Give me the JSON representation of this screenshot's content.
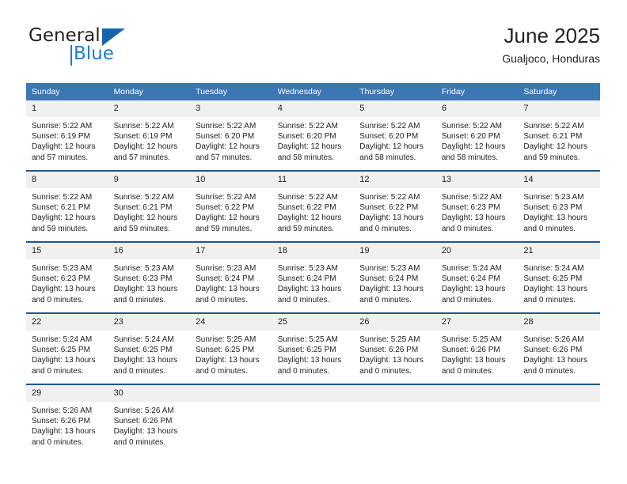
{
  "brand": {
    "name_top": "General",
    "name_bottom": "Blue",
    "accent_color": "#1a7fd4",
    "triangle_color": "#1565ad"
  },
  "header": {
    "title": "June 2025",
    "subtitle": "Gualjoco, Honduras"
  },
  "theme": {
    "header_row_bg": "#3b76b5",
    "week_separator": "#21578f",
    "daynum_bg": "#f0f0f0",
    "text": "#222222"
  },
  "weekday_headers": [
    "Sunday",
    "Monday",
    "Tuesday",
    "Wednesday",
    "Thursday",
    "Friday",
    "Saturday"
  ],
  "labels": {
    "sunrise_prefix": "Sunrise: ",
    "sunset_prefix": "Sunset: ",
    "daylight_prefix": "Daylight: "
  },
  "weeks": [
    [
      {
        "day": "1",
        "sunrise": "Sunrise: 5:22 AM",
        "sunset": "Sunset: 6:19 PM",
        "daylight": "Daylight: 12 hours and 57 minutes."
      },
      {
        "day": "2",
        "sunrise": "Sunrise: 5:22 AM",
        "sunset": "Sunset: 6:19 PM",
        "daylight": "Daylight: 12 hours and 57 minutes."
      },
      {
        "day": "3",
        "sunrise": "Sunrise: 5:22 AM",
        "sunset": "Sunset: 6:20 PM",
        "daylight": "Daylight: 12 hours and 57 minutes."
      },
      {
        "day": "4",
        "sunrise": "Sunrise: 5:22 AM",
        "sunset": "Sunset: 6:20 PM",
        "daylight": "Daylight: 12 hours and 58 minutes."
      },
      {
        "day": "5",
        "sunrise": "Sunrise: 5:22 AM",
        "sunset": "Sunset: 6:20 PM",
        "daylight": "Daylight: 12 hours and 58 minutes."
      },
      {
        "day": "6",
        "sunrise": "Sunrise: 5:22 AM",
        "sunset": "Sunset: 6:20 PM",
        "daylight": "Daylight: 12 hours and 58 minutes."
      },
      {
        "day": "7",
        "sunrise": "Sunrise: 5:22 AM",
        "sunset": "Sunset: 6:21 PM",
        "daylight": "Daylight: 12 hours and 59 minutes."
      }
    ],
    [
      {
        "day": "8",
        "sunrise": "Sunrise: 5:22 AM",
        "sunset": "Sunset: 6:21 PM",
        "daylight": "Daylight: 12 hours and 59 minutes."
      },
      {
        "day": "9",
        "sunrise": "Sunrise: 5:22 AM",
        "sunset": "Sunset: 6:21 PM",
        "daylight": "Daylight: 12 hours and 59 minutes."
      },
      {
        "day": "10",
        "sunrise": "Sunrise: 5:22 AM",
        "sunset": "Sunset: 6:22 PM",
        "daylight": "Daylight: 12 hours and 59 minutes."
      },
      {
        "day": "11",
        "sunrise": "Sunrise: 5:22 AM",
        "sunset": "Sunset: 6:22 PM",
        "daylight": "Daylight: 12 hours and 59 minutes."
      },
      {
        "day": "12",
        "sunrise": "Sunrise: 5:22 AM",
        "sunset": "Sunset: 6:22 PM",
        "daylight": "Daylight: 13 hours and 0 minutes."
      },
      {
        "day": "13",
        "sunrise": "Sunrise: 5:22 AM",
        "sunset": "Sunset: 6:23 PM",
        "daylight": "Daylight: 13 hours and 0 minutes."
      },
      {
        "day": "14",
        "sunrise": "Sunrise: 5:23 AM",
        "sunset": "Sunset: 6:23 PM",
        "daylight": "Daylight: 13 hours and 0 minutes."
      }
    ],
    [
      {
        "day": "15",
        "sunrise": "Sunrise: 5:23 AM",
        "sunset": "Sunset: 6:23 PM",
        "daylight": "Daylight: 13 hours and 0 minutes."
      },
      {
        "day": "16",
        "sunrise": "Sunrise: 5:23 AM",
        "sunset": "Sunset: 6:23 PM",
        "daylight": "Daylight: 13 hours and 0 minutes."
      },
      {
        "day": "17",
        "sunrise": "Sunrise: 5:23 AM",
        "sunset": "Sunset: 6:24 PM",
        "daylight": "Daylight: 13 hours and 0 minutes."
      },
      {
        "day": "18",
        "sunrise": "Sunrise: 5:23 AM",
        "sunset": "Sunset: 6:24 PM",
        "daylight": "Daylight: 13 hours and 0 minutes."
      },
      {
        "day": "19",
        "sunrise": "Sunrise: 5:23 AM",
        "sunset": "Sunset: 6:24 PM",
        "daylight": "Daylight: 13 hours and 0 minutes."
      },
      {
        "day": "20",
        "sunrise": "Sunrise: 5:24 AM",
        "sunset": "Sunset: 6:24 PM",
        "daylight": "Daylight: 13 hours and 0 minutes."
      },
      {
        "day": "21",
        "sunrise": "Sunrise: 5:24 AM",
        "sunset": "Sunset: 6:25 PM",
        "daylight": "Daylight: 13 hours and 0 minutes."
      }
    ],
    [
      {
        "day": "22",
        "sunrise": "Sunrise: 5:24 AM",
        "sunset": "Sunset: 6:25 PM",
        "daylight": "Daylight: 13 hours and 0 minutes."
      },
      {
        "day": "23",
        "sunrise": "Sunrise: 5:24 AM",
        "sunset": "Sunset: 6:25 PM",
        "daylight": "Daylight: 13 hours and 0 minutes."
      },
      {
        "day": "24",
        "sunrise": "Sunrise: 5:25 AM",
        "sunset": "Sunset: 6:25 PM",
        "daylight": "Daylight: 13 hours and 0 minutes."
      },
      {
        "day": "25",
        "sunrise": "Sunrise: 5:25 AM",
        "sunset": "Sunset: 6:25 PM",
        "daylight": "Daylight: 13 hours and 0 minutes."
      },
      {
        "day": "26",
        "sunrise": "Sunrise: 5:25 AM",
        "sunset": "Sunset: 6:26 PM",
        "daylight": "Daylight: 13 hours and 0 minutes."
      },
      {
        "day": "27",
        "sunrise": "Sunrise: 5:25 AM",
        "sunset": "Sunset: 6:26 PM",
        "daylight": "Daylight: 13 hours and 0 minutes."
      },
      {
        "day": "28",
        "sunrise": "Sunrise: 5:26 AM",
        "sunset": "Sunset: 6:26 PM",
        "daylight": "Daylight: 13 hours and 0 minutes."
      }
    ],
    [
      {
        "day": "29",
        "sunrise": "Sunrise: 5:26 AM",
        "sunset": "Sunset: 6:26 PM",
        "daylight": "Daylight: 13 hours and 0 minutes."
      },
      {
        "day": "30",
        "sunrise": "Sunrise: 5:26 AM",
        "sunset": "Sunset: 6:26 PM",
        "daylight": "Daylight: 13 hours and 0 minutes."
      },
      {
        "day": "",
        "sunrise": "",
        "sunset": "",
        "daylight": ""
      },
      {
        "day": "",
        "sunrise": "",
        "sunset": "",
        "daylight": ""
      },
      {
        "day": "",
        "sunrise": "",
        "sunset": "",
        "daylight": ""
      },
      {
        "day": "",
        "sunrise": "",
        "sunset": "",
        "daylight": ""
      },
      {
        "day": "",
        "sunrise": "",
        "sunset": "",
        "daylight": ""
      }
    ]
  ]
}
